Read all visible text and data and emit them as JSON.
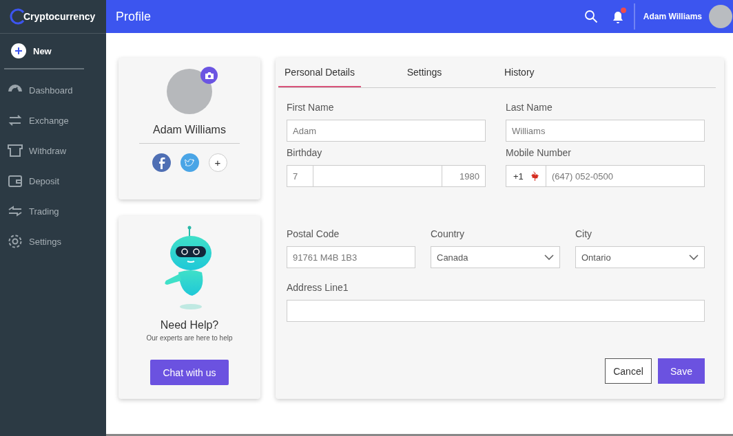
{
  "brand": "Cryptocurrency",
  "header": {
    "title": "Profile",
    "user_name": "Adam Williams",
    "notification_dot": true
  },
  "sidebar": {
    "new_label": "New",
    "items": [
      {
        "label": "Dashboard"
      },
      {
        "label": "Exchange"
      },
      {
        "label": "Withdraw"
      },
      {
        "label": "Deposit"
      },
      {
        "label": "Trading"
      },
      {
        "label": "Settings"
      }
    ]
  },
  "profile_card": {
    "name": "Adam Williams",
    "socials": [
      {
        "kind": "facebook"
      },
      {
        "kind": "twitter"
      },
      {
        "kind": "add",
        "label": "+"
      }
    ]
  },
  "help_card": {
    "title": "Need Help?",
    "subtitle": "Our experts are here to help",
    "button": "Chat with us"
  },
  "tabs": [
    {
      "label": "Personal Details",
      "selected": true
    },
    {
      "label": "Settings",
      "selected": false
    },
    {
      "label": "History",
      "selected": false
    }
  ],
  "form": {
    "first_name": {
      "label": "First Name",
      "value": "Adam"
    },
    "last_name": {
      "label": "Last Name",
      "value": "Williams"
    },
    "birthday": {
      "label": "Birthday",
      "day": "7",
      "year": "1980"
    },
    "mobile": {
      "label": "Mobile Number",
      "code": "+1",
      "value": "(647) 052-0500"
    },
    "postal": {
      "label": "Postal Code",
      "value": "91761 M4B 1B3"
    },
    "country": {
      "label": "Country",
      "value": "Canada"
    },
    "city": {
      "label": "City",
      "value": "Ontario"
    },
    "address": {
      "label": "Address Line1"
    }
  },
  "buttons": {
    "cancel": "Cancel",
    "save": "Save"
  }
}
